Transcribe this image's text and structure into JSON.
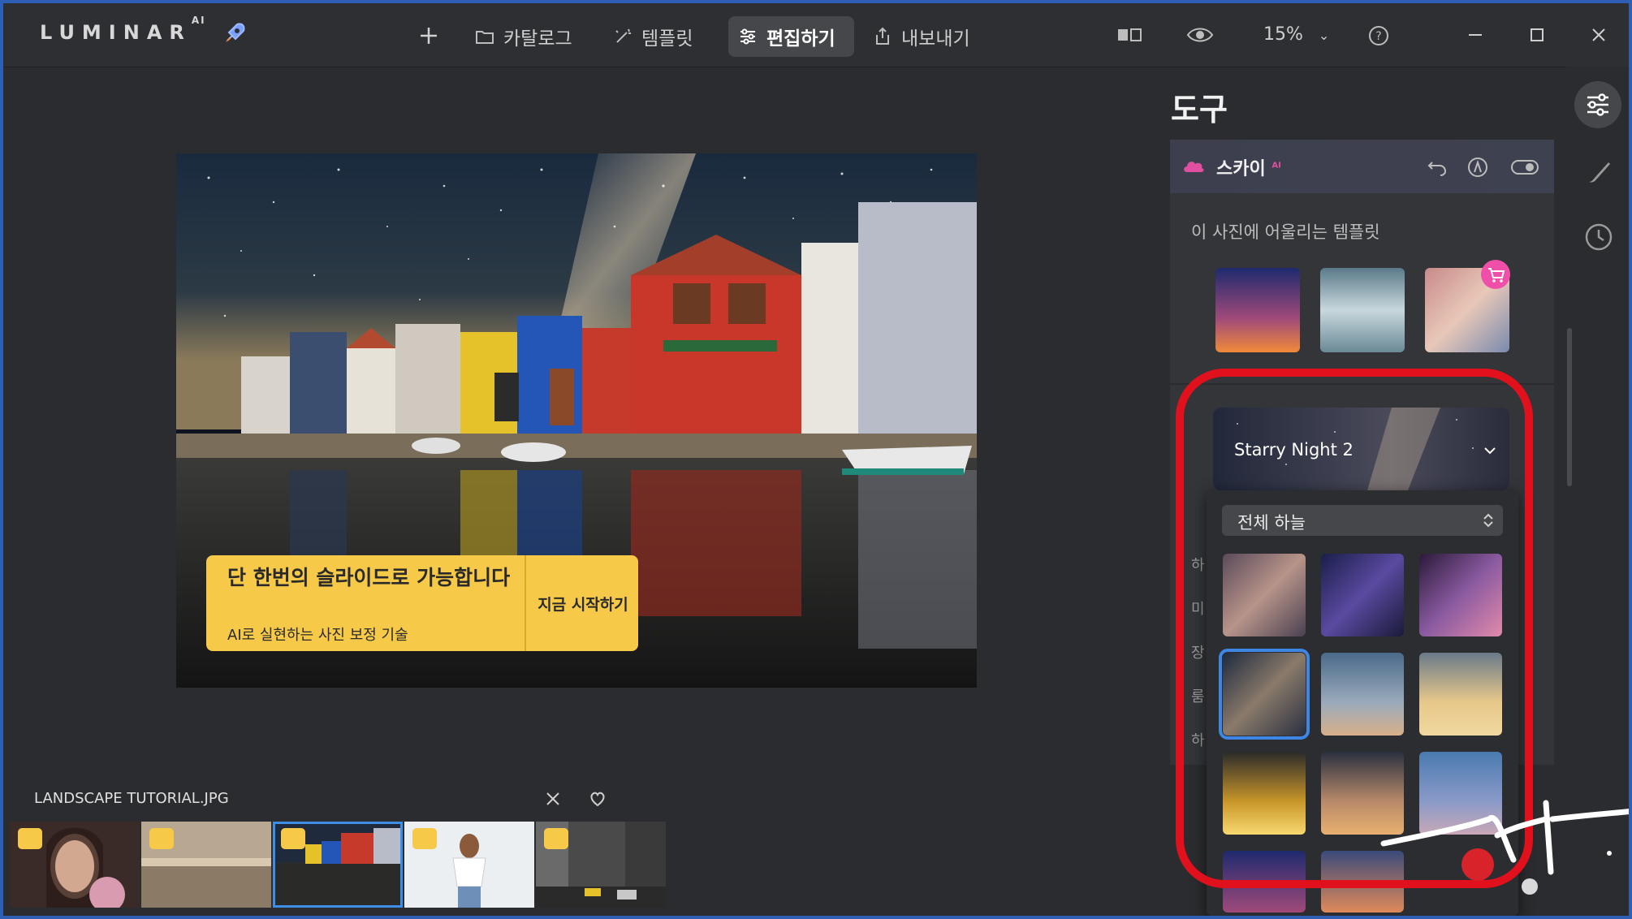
{
  "app": {
    "logo_text": "LUMINAR",
    "logo_sup": "AI"
  },
  "nav": {
    "catalog": "카탈로그",
    "templates": "템플릿",
    "edit": "편집하기",
    "export": "내보내기",
    "zoom": "15%"
  },
  "cta": {
    "title": "단 한번의 슬라이드로 가능합니다",
    "subtitle": "AI로 실현하는 사진 보정 기술",
    "button": "지금 시작하기"
  },
  "filmstrip": {
    "filename": "LANDSCAPE TUTORIAL.JPG"
  },
  "tools": {
    "title": "도구",
    "sky_label": "스카이",
    "sky_sup": "AI",
    "templates_label": "이 사진에 어울리는 템플릿",
    "sky_dropdown": "Starry Night 2",
    "category_select": "전체 하늘",
    "row_hints": [
      "하",
      "미",
      "장",
      "룸",
      "하"
    ]
  },
  "colors": {
    "accent": "#f7c948",
    "selection": "#3f8ee6",
    "annotation": "#e0101c",
    "window_border": "#2f5fb4"
  }
}
